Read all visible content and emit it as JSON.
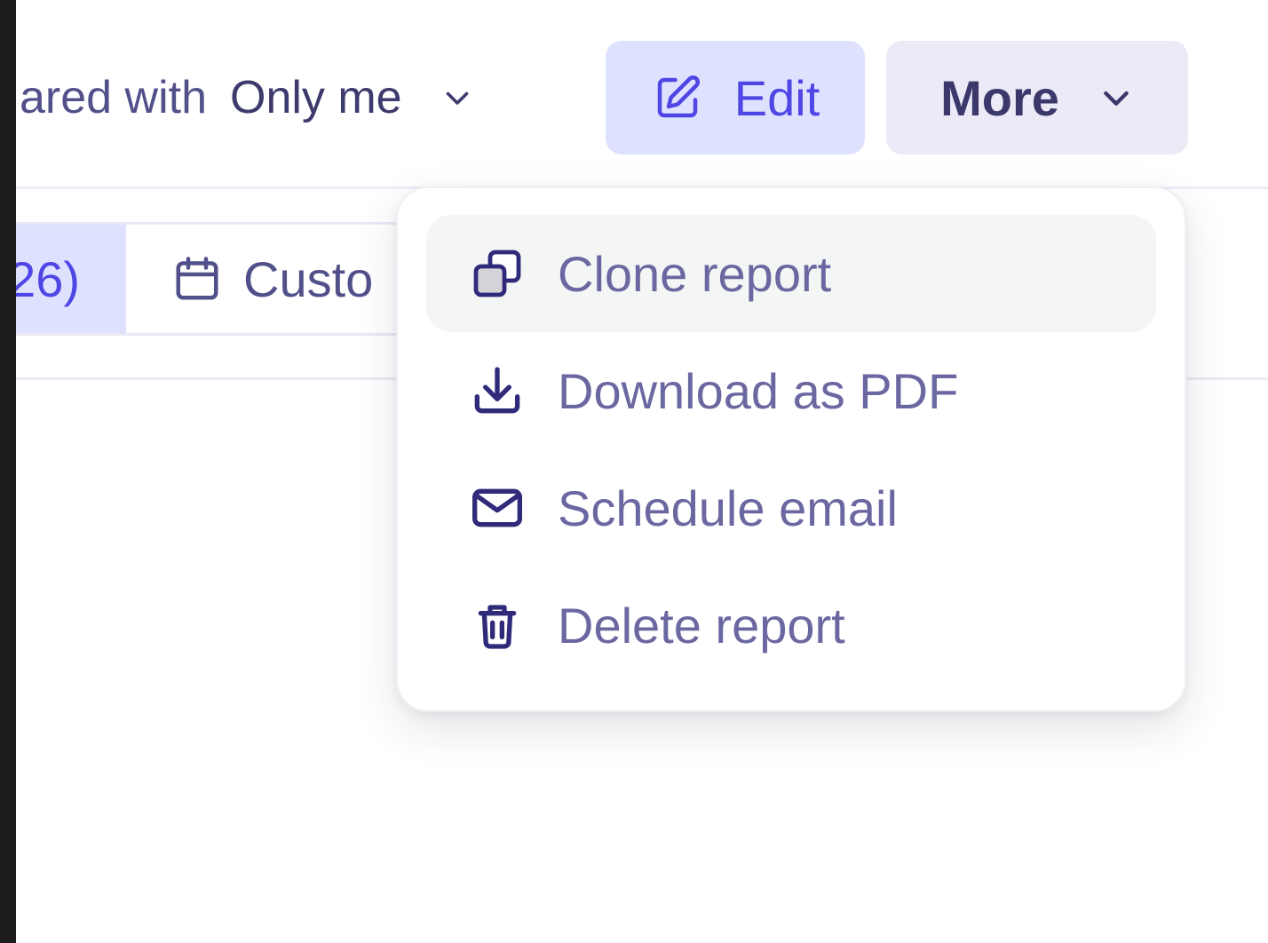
{
  "header": {
    "shared_with_label": "ared with",
    "shared_with_value": "Only me",
    "edit_label": "Edit",
    "more_label": "More"
  },
  "filters": {
    "range_label": "26)",
    "custom_label": "Custo"
  },
  "menu": {
    "items": [
      {
        "label": "Clone report",
        "icon": "clone-icon",
        "highlighted": true
      },
      {
        "label": "Download as PDF",
        "icon": "download-icon"
      },
      {
        "label": "Schedule email",
        "icon": "mail-icon"
      },
      {
        "label": "Delete report",
        "icon": "trash-icon"
      }
    ]
  },
  "colors": {
    "accent": "#4f46e5",
    "edit_bg": "#dfe2ff",
    "more_bg": "#ebeaf6",
    "menu_text": "#6b68a1",
    "icon_stroke": "#2f2a7a"
  }
}
